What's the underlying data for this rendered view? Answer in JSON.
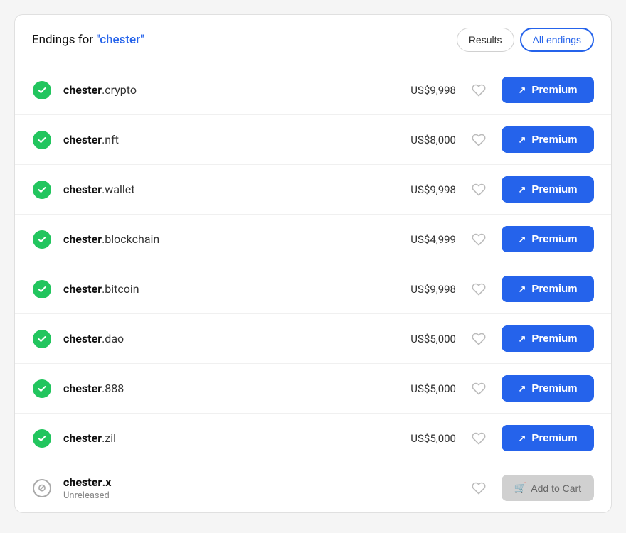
{
  "header": {
    "title_prefix": "Endings for ",
    "title_query": "\"chester\"",
    "btn_results": "Results",
    "btn_all_endings": "All endings"
  },
  "domains": [
    {
      "id": 1,
      "base": "chester",
      "ext": ".crypto",
      "price": "US$9,998",
      "status": "available",
      "action": "premium"
    },
    {
      "id": 2,
      "base": "chester",
      "ext": ".nft",
      "price": "US$8,000",
      "status": "available",
      "action": "premium"
    },
    {
      "id": 3,
      "base": "chester",
      "ext": ".wallet",
      "price": "US$9,998",
      "status": "available",
      "action": "premium"
    },
    {
      "id": 4,
      "base": "chester",
      "ext": ".blockchain",
      "price": "US$4,999",
      "status": "available",
      "action": "premium"
    },
    {
      "id": 5,
      "base": "chester",
      "ext": ".bitcoin",
      "price": "US$9,998",
      "status": "available",
      "action": "premium"
    },
    {
      "id": 6,
      "base": "chester",
      "ext": ".dao",
      "price": "US$5,000",
      "status": "available",
      "action": "premium"
    },
    {
      "id": 7,
      "base": "chester",
      "ext": ".888",
      "price": "US$5,000",
      "status": "available",
      "action": "premium"
    },
    {
      "id": 8,
      "base": "chester",
      "ext": ".zil",
      "price": "US$5,000",
      "status": "available",
      "action": "premium"
    },
    {
      "id": 9,
      "base": "chester",
      "ext": ".x",
      "price": "",
      "status": "unreleased",
      "action": "add_to_cart",
      "sub_label": "Unreleased"
    }
  ],
  "labels": {
    "premium": "Premium",
    "add_to_cart": "Add to Cart"
  },
  "colors": {
    "primary": "#2563eb",
    "available": "#22c55e"
  }
}
